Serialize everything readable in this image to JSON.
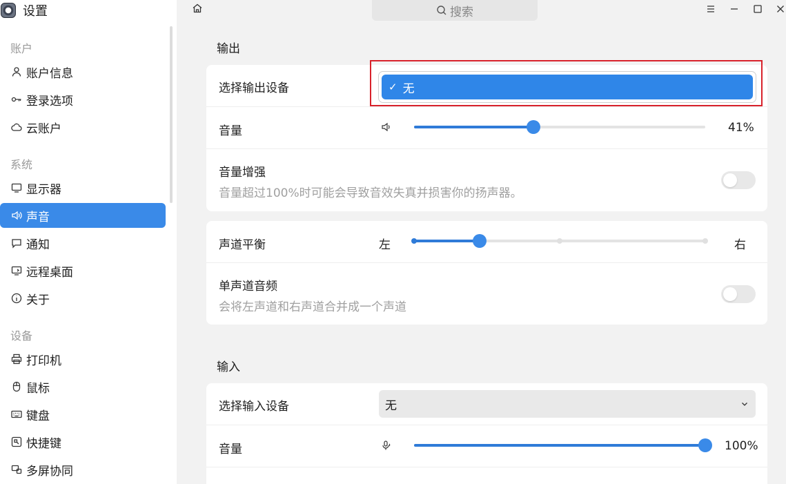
{
  "app": {
    "title": "设置"
  },
  "search": {
    "placeholder": "搜索"
  },
  "sidebar": {
    "sections": [
      {
        "label": "账户"
      },
      {
        "label": "系统"
      },
      {
        "label": "设备"
      }
    ],
    "items": [
      {
        "label": "账户信息",
        "icon": "user-icon"
      },
      {
        "label": "登录选项",
        "icon": "key-icon"
      },
      {
        "label": "云账户",
        "icon": "cloud-icon"
      },
      {
        "label": "显示器",
        "icon": "monitor-icon"
      },
      {
        "label": "声音",
        "icon": "speaker-icon",
        "active": true
      },
      {
        "label": "通知",
        "icon": "message-icon"
      },
      {
        "label": "远程桌面",
        "icon": "remote-desktop-icon"
      },
      {
        "label": "关于",
        "icon": "info-icon"
      },
      {
        "label": "打印机",
        "icon": "printer-icon"
      },
      {
        "label": "鼠标",
        "icon": "mouse-icon"
      },
      {
        "label": "键盘",
        "icon": "keyboard-icon"
      },
      {
        "label": "快捷键",
        "icon": "shortcut-icon"
      },
      {
        "label": "多屏协同",
        "icon": "multi-screen-icon"
      }
    ]
  },
  "output": {
    "title": "输出",
    "device_label": "选择输出设备",
    "device_option": "无",
    "volume_label": "音量",
    "volume_value": "41%",
    "volume_level": 0.41,
    "boost_label": "音量增强",
    "boost_desc": "音量超过100%时可能会导致音效失真并损害你的扬声器。",
    "boost_on": false,
    "balance_label": "声道平衡",
    "balance_left": "左",
    "balance_right": "右",
    "balance_level": 0.225,
    "mono_label": "单声道音频",
    "mono_desc": "会将左声道和右声道合并成一个声道",
    "mono_on": false
  },
  "input": {
    "title": "输入",
    "device_label": "选择输入设备",
    "device_value": "无",
    "volume_label": "音量",
    "volume_value": "100%",
    "volume_level": 1.0
  },
  "colors": {
    "accent": "#3a8ae8",
    "highlight_border": "#d8212a"
  }
}
